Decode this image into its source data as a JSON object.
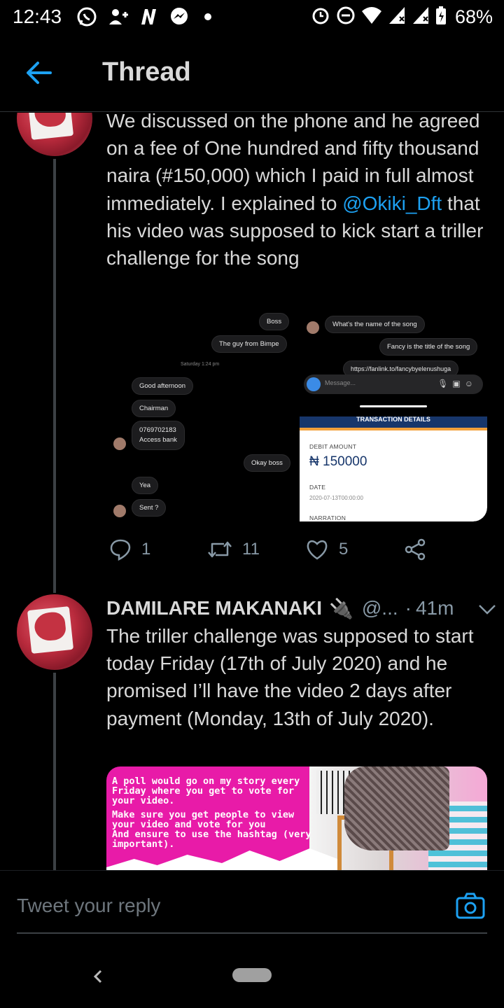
{
  "status_bar": {
    "time": "12:43",
    "battery": "68%",
    "left_icons": [
      "whatsapp-icon",
      "add-person-icon",
      "n-icon",
      "messenger-icon",
      "dot"
    ],
    "right_icons": [
      "alarm-icon",
      "dnd-icon",
      "wifi-icon",
      "signal-icon",
      "signal-icon",
      "battery-icon"
    ]
  },
  "header": {
    "title": "Thread",
    "back_icon": "arrow-left-icon"
  },
  "tweet1": {
    "text_before_mention": "We discussed on the phone and he agreed on a fee of One hundred and fifty thousand naira (#150,000) which I paid in full almost immediately. I explained to ",
    "mention": "@Okiki_Dft",
    "text_after_mention": " that his video was supposed to kick start a triller challenge for the song",
    "chat_left": {
      "boss": "Boss",
      "guy_from_bimpe": "The guy from Bimpe",
      "date": "Saturday 1:24 pm",
      "good_afternoon": "Good afternoon",
      "chairman": "Chairman",
      "account_line1": "0769702183",
      "account_line2": "Access bank",
      "okay_boss": "Okay boss",
      "yea": "Yea",
      "sent": "Sent ?"
    },
    "chat_right": {
      "name_question": "What's the name of the song",
      "title_answer": "Fancy is the title of the song",
      "link": "https://fanlink.to/fancybyelenushuga",
      "message_placeholder": "Message..."
    },
    "bank": {
      "header": "TRANSACTION DETAILS",
      "debit_label": "DEBIT AMOUNT",
      "amount": "₦ 150000",
      "date_label": "DATE",
      "date_value": "2020-07-13T00:00:00",
      "narration_label": "NARRATION"
    },
    "actions": {
      "replies": "1",
      "retweets": "11",
      "likes": "5"
    }
  },
  "tweet2": {
    "name": "DAMILARE MAKANAKI",
    "name_emoji": "🔌",
    "handle": "@...",
    "separator": "·",
    "time": "41m",
    "text": "The triller challenge was supposed to start today Friday (17th of July 2020) and he promised I’ll have the video 2 days after payment (Monday, 13th of July 2020).",
    "media_text_1": "A poll would go on my story every Friday where you get to vote for your video.",
    "media_text_2": "Make sure you get people to view your video and vote for you\nAnd ensure to use the hashtag (very important)."
  },
  "reply_bar": {
    "placeholder": "Tweet your reply"
  },
  "colors": {
    "background": "#000000",
    "text": "#d9d9d9",
    "accent": "#1da1f2",
    "muted": "#8899a6",
    "pink": "#e81ba8"
  }
}
